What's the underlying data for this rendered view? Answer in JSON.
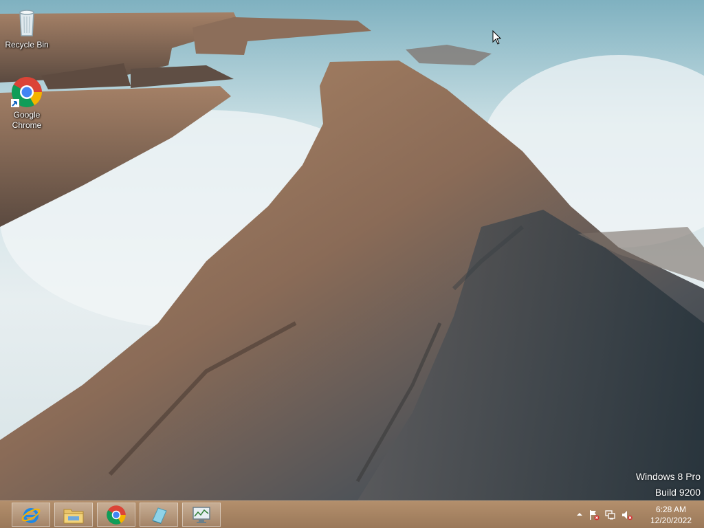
{
  "desktop": {
    "icons": [
      {
        "label": "Recycle Bin",
        "icon": "recycle-bin-icon"
      },
      {
        "label": "Google Chrome",
        "icon": "chrome-icon"
      }
    ],
    "watermark": {
      "edition": "Windows 8 Pro",
      "build": "Build 9200"
    }
  },
  "taskbar": {
    "pinned": [
      {
        "app": "Internet Explorer",
        "icon": "internet-explorer-icon"
      },
      {
        "app": "File Explorer",
        "icon": "file-explorer-icon"
      },
      {
        "app": "Google Chrome",
        "icon": "chrome-icon"
      },
      {
        "app": "Application",
        "icon": "app-tile-icon"
      },
      {
        "app": "Application",
        "icon": "monitor-app-icon"
      }
    ],
    "tray": {
      "icons": [
        "show-hidden-icons-chevron",
        "action-center-flag-icon",
        "network-icon",
        "volume-muted-icon"
      ],
      "time": "6:28 AM",
      "date": "12/20/2022"
    },
    "colors": {
      "bar": "#a98565",
      "text": "#ffffff"
    }
  }
}
